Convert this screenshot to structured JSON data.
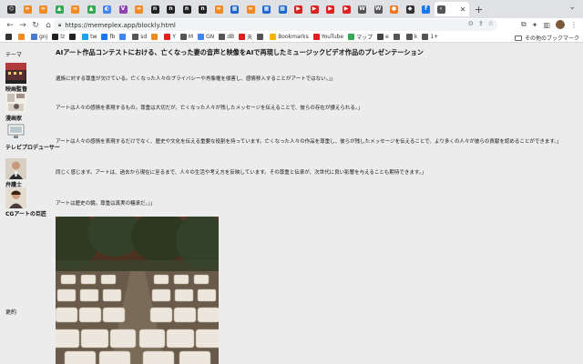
{
  "browser": {
    "address": "https://memeplex.app/blockly.html",
    "tabs": [
      {
        "glyph": "⌬",
        "color": "#333333"
      },
      {
        "glyph": "∞",
        "color": "#f08a24"
      },
      {
        "glyph": "∞",
        "color": "#f08a24"
      },
      {
        "glyph": "▲",
        "color": "#34a853"
      },
      {
        "glyph": "∞",
        "color": "#f08a24"
      },
      {
        "glyph": "▲",
        "color": "#34a853"
      },
      {
        "glyph": "◐",
        "color": "#4285f4"
      },
      {
        "glyph": "V",
        "color": "#8e44ad"
      },
      {
        "glyph": "∞",
        "color": "#f08a24"
      },
      {
        "glyph": "n",
        "color": "#222222"
      },
      {
        "glyph": "n",
        "color": "#222222"
      },
      {
        "glyph": "n",
        "color": "#222222"
      },
      {
        "glyph": "n",
        "color": "#222222"
      },
      {
        "glyph": "∞",
        "color": "#f08a24"
      },
      {
        "glyph": "▦",
        "color": "#1e66d0"
      },
      {
        "glyph": "∞",
        "color": "#f08a24"
      },
      {
        "glyph": "▦",
        "color": "#1e66d0"
      },
      {
        "glyph": "▦",
        "color": "#1e66d0"
      },
      {
        "glyph": "▶",
        "color": "#e02020"
      },
      {
        "glyph": "▶",
        "color": "#e02020"
      },
      {
        "glyph": "▶",
        "color": "#e02020"
      },
      {
        "glyph": "▶",
        "color": "#e02020"
      },
      {
        "glyph": "W",
        "color": "#555555"
      },
      {
        "glyph": "W",
        "color": "#555555"
      },
      {
        "glyph": "●",
        "color": "#f0781e"
      },
      {
        "glyph": "◆",
        "color": "#333333"
      },
      {
        "glyph": "f",
        "color": "#1877f2"
      }
    ]
  },
  "bookmarks": [
    {
      "label": "",
      "color": "#333333"
    },
    {
      "label": "",
      "color": "#f08a24"
    },
    {
      "label": "gnj",
      "color": "#4a7bd0"
    },
    {
      "label": "lz",
      "color": "#222222"
    },
    {
      "label": "",
      "color": "#222222"
    },
    {
      "label": "tw",
      "color": "#1da1f2"
    },
    {
      "label": "fb",
      "color": "#1877f2"
    },
    {
      "label": "",
      "color": "#4285f4"
    },
    {
      "label": "sd",
      "color": "#555555"
    },
    {
      "label": "",
      "color": "#f08a24"
    },
    {
      "label": "Y",
      "color": "#e02020"
    },
    {
      "label": "M",
      "color": "#555555"
    },
    {
      "label": "GN",
      "color": "#4285f4"
    },
    {
      "label": "dB",
      "color": "#555555"
    },
    {
      "label": "天",
      "color": "#e02020"
    },
    {
      "label": "",
      "color": "#555555"
    },
    {
      "label": "Bookmarks",
      "color": "#f4b400"
    },
    {
      "label": "YouTube",
      "color": "#e02020"
    },
    {
      "label": "マップ",
      "color": "#34a853"
    },
    {
      "label": "e",
      "color": "#444444"
    },
    {
      "label": "",
      "color": "#555555"
    },
    {
      "label": "k",
      "color": "#555555"
    },
    {
      "label": "1+",
      "color": "#555555"
    }
  ],
  "bookmarks_other": "その他のブックマーク",
  "sidebar": {
    "title": "テーマ",
    "items": [
      {
        "label": "映画監督",
        "pic": "film-director"
      },
      {
        "label": "漫画家",
        "pic": "manga-artist"
      },
      {
        "label": "テレビプロデューサー",
        "pic": "tv-producer"
      },
      {
        "label": "弁護士",
        "pic": "lawyer"
      },
      {
        "label": "CGアートの巨匠",
        "pic": "cg-artist"
      }
    ],
    "footer": "更約"
  },
  "main": {
    "heading": "AIアート作品コンテストにおける、亡くなった妻の音声と映像をAIで再現したミュージックビデオ作品のプレゼンテーション",
    "paragraphs": [
      "遺族に対する尊重が欠けている。亡くなった人々のプライバシーや肖像権を侵害し、感情移入することがアートではない。」」",
      "アートは人々の感情を表現するもの。尊重は大切だが、亡くなった人々が残したメッセージを伝えることで、彼らの存在が讃えられる。」",
      "アートは人々の感情を表現するだけでなく、歴史や文化を伝える重要な役割を持っています。亡くなった人々の作品を尊重し、彼らが残したメッセージを伝えることで、より多くの人々が彼らの貢献を認めることができます。」",
      "同じく感じます。アートは、過去から現在に至るまで、人々の生活や考え方を反映しています。その尊重と伝承が、次世代に良い影響を与えることも期待できます。」",
      "アートは歴史の鏡。尊重は真実の糖承だ。」」"
    ]
  }
}
